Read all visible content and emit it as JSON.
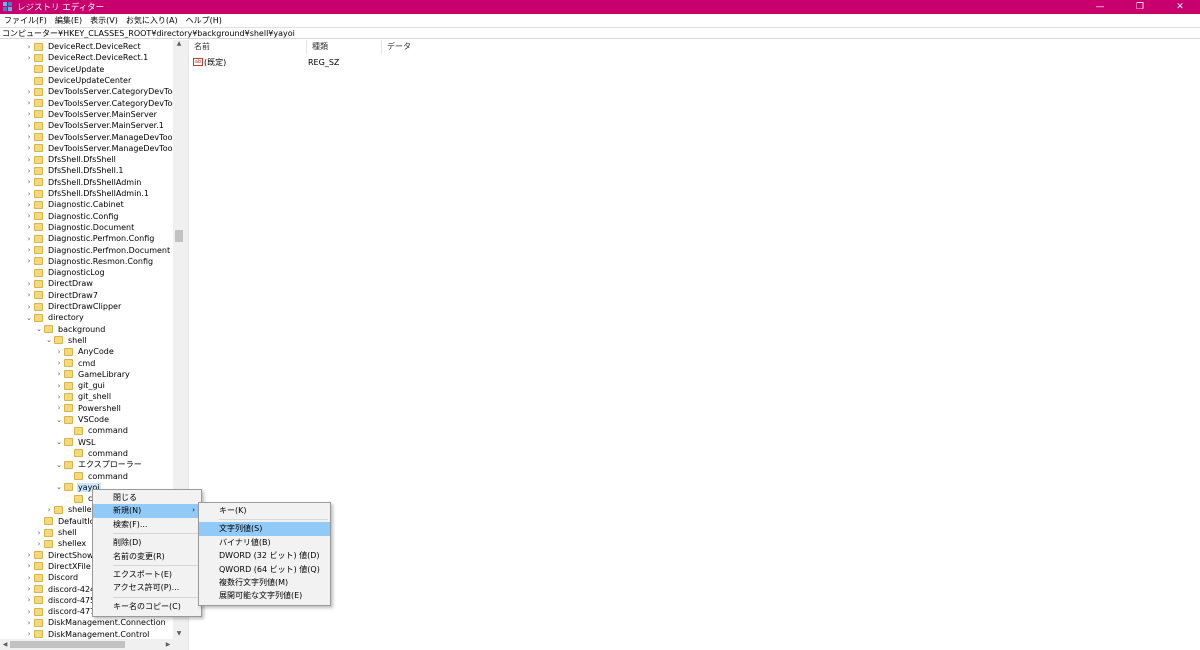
{
  "window": {
    "title": "レジストリ エディター",
    "controls": {
      "minimize": "—",
      "maximize": "❐",
      "close": "✕"
    }
  },
  "menubar": [
    "ファイル(F)",
    "編集(E)",
    "表示(V)",
    "お気に入り(A)",
    "ヘルプ(H)"
  ],
  "address": "コンピューター¥HKEY_CLASSES_ROOT¥directory¥background¥shell¥yayoi",
  "tree": [
    {
      "label": "DeviceRect.DeviceRect",
      "depth": 0,
      "chev": "right"
    },
    {
      "label": "DeviceRect.DeviceRect.1",
      "depth": 0,
      "chev": "right"
    },
    {
      "label": "DeviceUpdate",
      "depth": 0,
      "chev": "none"
    },
    {
      "label": "DeviceUpdateCenter",
      "depth": 0,
      "chev": "none"
    },
    {
      "label": "DevToolsServer.CategoryDevTools",
      "depth": 0,
      "chev": "right"
    },
    {
      "label": "DevToolsServer.CategoryDevTools.1",
      "depth": 0,
      "chev": "right"
    },
    {
      "label": "DevToolsServer.MainServer",
      "depth": 0,
      "chev": "right"
    },
    {
      "label": "DevToolsServer.MainServer.1",
      "depth": 0,
      "chev": "right"
    },
    {
      "label": "DevToolsServer.ManageDevTools",
      "depth": 0,
      "chev": "right"
    },
    {
      "label": "DevToolsServer.ManageDevTools.1",
      "depth": 0,
      "chev": "right"
    },
    {
      "label": "DfsShell.DfsShell",
      "depth": 0,
      "chev": "right"
    },
    {
      "label": "DfsShell.DfsShell.1",
      "depth": 0,
      "chev": "right"
    },
    {
      "label": "DfsShell.DfsShellAdmin",
      "depth": 0,
      "chev": "right"
    },
    {
      "label": "DfsShell.DfsShellAdmin.1",
      "depth": 0,
      "chev": "right"
    },
    {
      "label": "Diagnostic.Cabinet",
      "depth": 0,
      "chev": "right"
    },
    {
      "label": "Diagnostic.Config",
      "depth": 0,
      "chev": "right"
    },
    {
      "label": "Diagnostic.Document",
      "depth": 0,
      "chev": "right"
    },
    {
      "label": "Diagnostic.Perfmon.Config",
      "depth": 0,
      "chev": "right"
    },
    {
      "label": "Diagnostic.Perfmon.Document",
      "depth": 0,
      "chev": "right"
    },
    {
      "label": "Diagnostic.Resmon.Config",
      "depth": 0,
      "chev": "right"
    },
    {
      "label": "DiagnosticLog",
      "depth": 0,
      "chev": "none"
    },
    {
      "label": "DirectDraw",
      "depth": 0,
      "chev": "right"
    },
    {
      "label": "DirectDraw7",
      "depth": 0,
      "chev": "right"
    },
    {
      "label": "DirectDrawClipper",
      "depth": 0,
      "chev": "right"
    },
    {
      "label": "directory",
      "depth": 0,
      "chev": "down"
    },
    {
      "label": "background",
      "depth": 1,
      "chev": "down"
    },
    {
      "label": "shell",
      "depth": 2,
      "chev": "down"
    },
    {
      "label": "AnyCode",
      "depth": 3,
      "chev": "right"
    },
    {
      "label": "cmd",
      "depth": 3,
      "chev": "right"
    },
    {
      "label": "GameLibrary",
      "depth": 3,
      "chev": "right"
    },
    {
      "label": "git_gui",
      "depth": 3,
      "chev": "right"
    },
    {
      "label": "git_shell",
      "depth": 3,
      "chev": "right"
    },
    {
      "label": "Powershell",
      "depth": 3,
      "chev": "right"
    },
    {
      "label": "VSCode",
      "depth": 3,
      "chev": "down"
    },
    {
      "label": "command",
      "depth": 4,
      "chev": "none"
    },
    {
      "label": "WSL",
      "depth": 3,
      "chev": "down"
    },
    {
      "label": "command",
      "depth": 4,
      "chev": "none"
    },
    {
      "label": "エクスプローラー",
      "depth": 3,
      "chev": "down"
    },
    {
      "label": "command",
      "depth": 4,
      "chev": "none"
    },
    {
      "label": "yayoi",
      "depth": 3,
      "chev": "down",
      "selected": true
    },
    {
      "label": "co",
      "depth": 4,
      "chev": "none"
    },
    {
      "label": "shellex",
      "depth": 2,
      "chev": "right"
    },
    {
      "label": "DefaultIcon",
      "depth": 1,
      "chev": "none"
    },
    {
      "label": "shell",
      "depth": 1,
      "chev": "right"
    },
    {
      "label": "shellex",
      "depth": 1,
      "chev": "right"
    },
    {
      "label": "DirectShow",
      "depth": 0,
      "chev": "right"
    },
    {
      "label": "DirectXFile",
      "depth": 0,
      "chev": "right"
    },
    {
      "label": "Discord",
      "depth": 0,
      "chev": "right"
    },
    {
      "label": "discord-4240",
      "depth": 0,
      "chev": "right"
    },
    {
      "label": "discord-4750",
      "depth": 0,
      "chev": "right"
    },
    {
      "label": "discord-4771",
      "depth": 0,
      "chev": "right"
    },
    {
      "label": "DiskManagement.Connection",
      "depth": 0,
      "chev": "right"
    },
    {
      "label": "DiskManagement.Control",
      "depth": 0,
      "chev": "right"
    }
  ],
  "list": {
    "headers": [
      "名前",
      "種類",
      "データ"
    ],
    "rows": [
      {
        "icon": "ab",
        "name": "(既定)",
        "type": "REG_SZ",
        "data": ""
      }
    ]
  },
  "context_menu": {
    "items": [
      {
        "label": "閉じる",
        "type": "item"
      },
      {
        "label": "新規(N)",
        "type": "submenu",
        "highlighted": true
      },
      {
        "label": "検索(F)...",
        "type": "item"
      },
      {
        "type": "sep"
      },
      {
        "label": "削除(D)",
        "type": "item"
      },
      {
        "label": "名前の変更(R)",
        "type": "item"
      },
      {
        "type": "sep"
      },
      {
        "label": "エクスポート(E)",
        "type": "item"
      },
      {
        "label": "アクセス許可(P)...",
        "type": "item"
      },
      {
        "type": "sep"
      },
      {
        "label": "キー名のコピー(C)",
        "type": "item"
      }
    ],
    "submenu_arrow": "›"
  },
  "submenu": {
    "items": [
      {
        "label": "キー(K)",
        "type": "item"
      },
      {
        "type": "sep"
      },
      {
        "label": "文字列値(S)",
        "type": "item",
        "highlighted": true
      },
      {
        "label": "バイナリ値(B)",
        "type": "item"
      },
      {
        "label": "DWORD (32 ビット) 値(D)",
        "type": "item"
      },
      {
        "label": "QWORD (64 ビット) 値(Q)",
        "type": "item"
      },
      {
        "label": "複数行文字列値(M)",
        "type": "item"
      },
      {
        "label": "展開可能な文字列値(E)",
        "type": "item"
      }
    ]
  },
  "colors": {
    "titlebar": "#c8006e",
    "highlight": "#91c9f7",
    "selection": "#cce8ff"
  }
}
